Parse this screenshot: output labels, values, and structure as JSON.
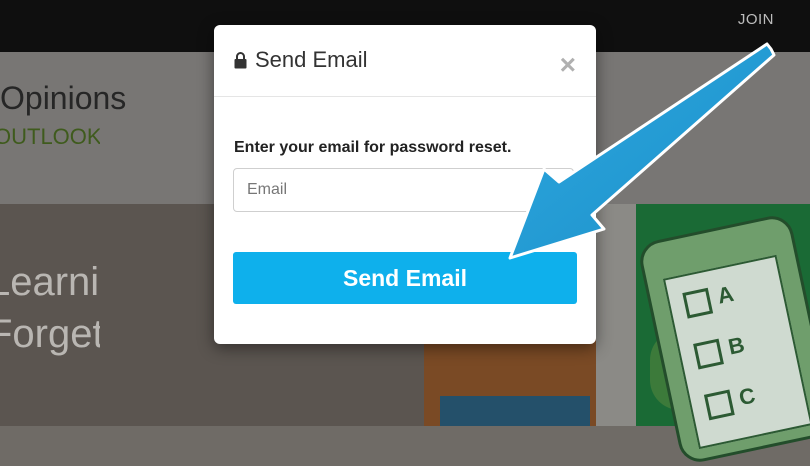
{
  "nav": {
    "join_label": "JOIN"
  },
  "header": {
    "brand_line1": "Opinions",
    "brand_line2": "OUTLOOK GROUP"
  },
  "hero": {
    "line1": "Learning",
    "line2": "Forget in"
  },
  "modal": {
    "title": "Send Email",
    "title_icon": "lock-icon",
    "close_label": "×",
    "prompt": "Enter your email for password reset.",
    "email_placeholder": "Email",
    "email_value": "",
    "submit_label": "Send Email"
  },
  "illustration": {
    "options": [
      "A",
      "B",
      "C"
    ]
  },
  "colors": {
    "accent": "#0eb0ec",
    "arrow": "#2aa3dc",
    "topbar": "#0f0f0f"
  }
}
